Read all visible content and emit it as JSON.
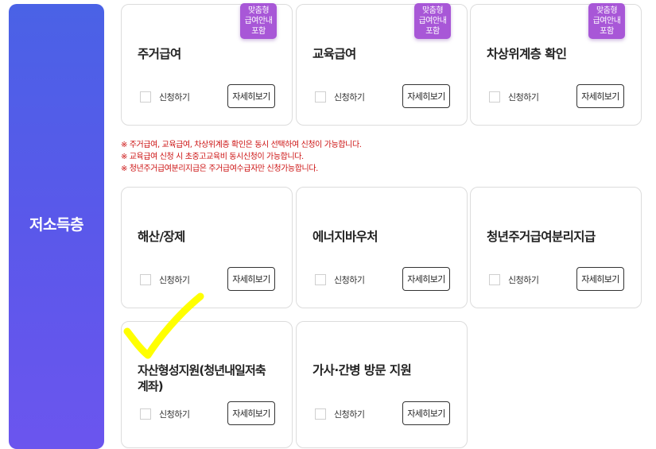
{
  "sidebar": {
    "title": "저소득층"
  },
  "common": {
    "apply_label": "신청하기",
    "detail_label": "자세히보기"
  },
  "badge": {
    "line1": "맞춤형",
    "line2": "급여안내",
    "line3": "포함"
  },
  "cards": [
    {
      "title": "주거급여"
    },
    {
      "title": "교육급여"
    },
    {
      "title": "차상위계층 확인"
    },
    {
      "title": "해산/장제"
    },
    {
      "title": "에너지바우처"
    },
    {
      "title": "청년주거급여분리지급"
    },
    {
      "title_line1": "자산형성지원(청년내일저축",
      "title_line2": "계좌)"
    },
    {
      "title": "가사·간병 방문 지원"
    }
  ],
  "notices": [
    "※ 주거급여, 교육급여, 차상위계층 확인은 동시 선택하여 신청이 가능합니다.",
    "※ 교육급여 신청 시 초중고교육비 동시신청이 가능합니다.",
    "※ 청년주거급여분리지급은 주거급여수급자만 신청가능합니다."
  ],
  "colors": {
    "sidebar_top": "#4a62e6",
    "sidebar_bottom": "#6b55ee",
    "badge": "#a857d7",
    "notice": "#cc1111",
    "annotation": "#ffff00"
  }
}
